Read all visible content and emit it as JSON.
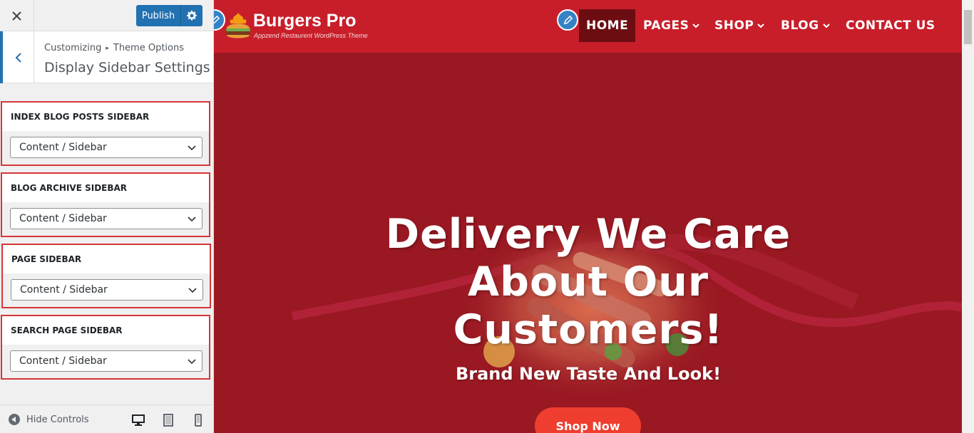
{
  "customizer": {
    "close_icon": "close-icon",
    "publish_label": "Publish",
    "gear_icon": "gear-icon",
    "back_icon": "chevron-left-icon",
    "breadcrumb": {
      "root": "Customizing",
      "separator": "▸",
      "parent": "Theme Options"
    },
    "section_title": "Display Sidebar Settings",
    "controls": [
      {
        "label": "Index Blog Posts Sidebar",
        "value": "Content / Sidebar"
      },
      {
        "label": "Blog Archive Sidebar",
        "value": "Content / Sidebar"
      },
      {
        "label": "Page Sidebar",
        "value": "Content / Sidebar"
      },
      {
        "label": "Search Page Sidebar",
        "value": "Content / Sidebar"
      }
    ],
    "highlight_color": "#d63638",
    "accent_color": "#2271b1",
    "footer": {
      "hide_controls_label": "Hide Controls",
      "devices": [
        "desktop-icon",
        "tablet-icon",
        "mobile-icon"
      ]
    }
  },
  "preview": {
    "brand_name": "Burgers Pro",
    "tagline": "Appzend Restaurent WordPress Theme",
    "nav": [
      {
        "label": "HOME",
        "active": true,
        "dropdown": false
      },
      {
        "label": "PAGES",
        "active": false,
        "dropdown": true
      },
      {
        "label": "SHOP",
        "active": false,
        "dropdown": true
      },
      {
        "label": "BLOG",
        "active": false,
        "dropdown": true
      },
      {
        "label": "CONTACT US",
        "active": false,
        "dropdown": false
      }
    ],
    "hero": {
      "title_lines": [
        "Delivery We Care",
        "About Our",
        "Customers!"
      ],
      "subtitle": "Brand New Taste And Look!",
      "button": "Shop Now"
    },
    "colors": {
      "header": "#c81e2a",
      "hero": "#9a1822",
      "button": "#ef3e2f"
    }
  }
}
